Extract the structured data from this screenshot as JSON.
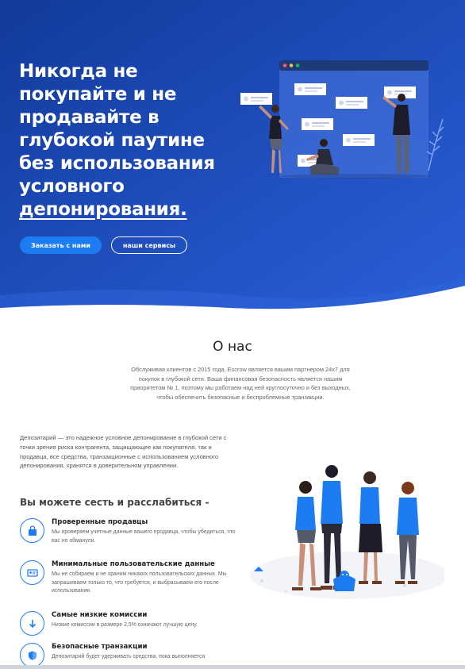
{
  "hero": {
    "title_lines": [
      "Никогда не",
      "покупайте и не",
      "продавайте в",
      "глубокой паутине",
      "без использования",
      "условного"
    ],
    "title_underlined": "депонирования.",
    "order_button": "Заказать с нами",
    "services_button": "наши сервисы",
    "colors": {
      "gradient_start": "#123a9b",
      "gradient_end": "#2b5fd8",
      "accent": "#1d7cf2"
    }
  },
  "about": {
    "title": "О нас",
    "text": "Обслуживая клиентов с 2015 года, Escrow является вашим партнером 24x7 для покупок в глубокой сети. Ваша финансовая безопасность является нашим приоритетом № 1, поэтому мы работаем над ней круглосуточно и без выходных, чтобы обеспечить безопасные и беспроблемные транзакции."
  },
  "intro": "Депозитарий — это надежное условное депонирование в глубокой сети с точки зрения риска контрагента, защищающее как покупателя, так и продавца, все средства, транзакционные с использованием условного депонирования, хранятся в доверительном управлении.",
  "relax_heading": "Вы можете сесть и расслабиться -",
  "features": [
    {
      "icon": "shopping-bag-icon",
      "title": "Проверенные продавцы",
      "desc": "Мы проверяем учетные данные вашего продавца, чтобы убедиться, что вас не обманули."
    },
    {
      "icon": "id-card-icon",
      "title": "Минимальные пользовательские данные",
      "desc": "Мы не собираем и не храним никаких пользовательских данных. Мы запрашиваем только то, что требуется, и выбрасываем его после использования."
    },
    {
      "icon": "arrow-down-icon",
      "title": "Самые низкие комиссии",
      "desc": "Низкие комиссии в размере 2,5% означают лучшую цену."
    },
    {
      "icon": "shield-icon",
      "title": "Безопасные транзакции",
      "desc": "Депозитарий будет удерживать средства, пока выполняется"
    }
  ]
}
